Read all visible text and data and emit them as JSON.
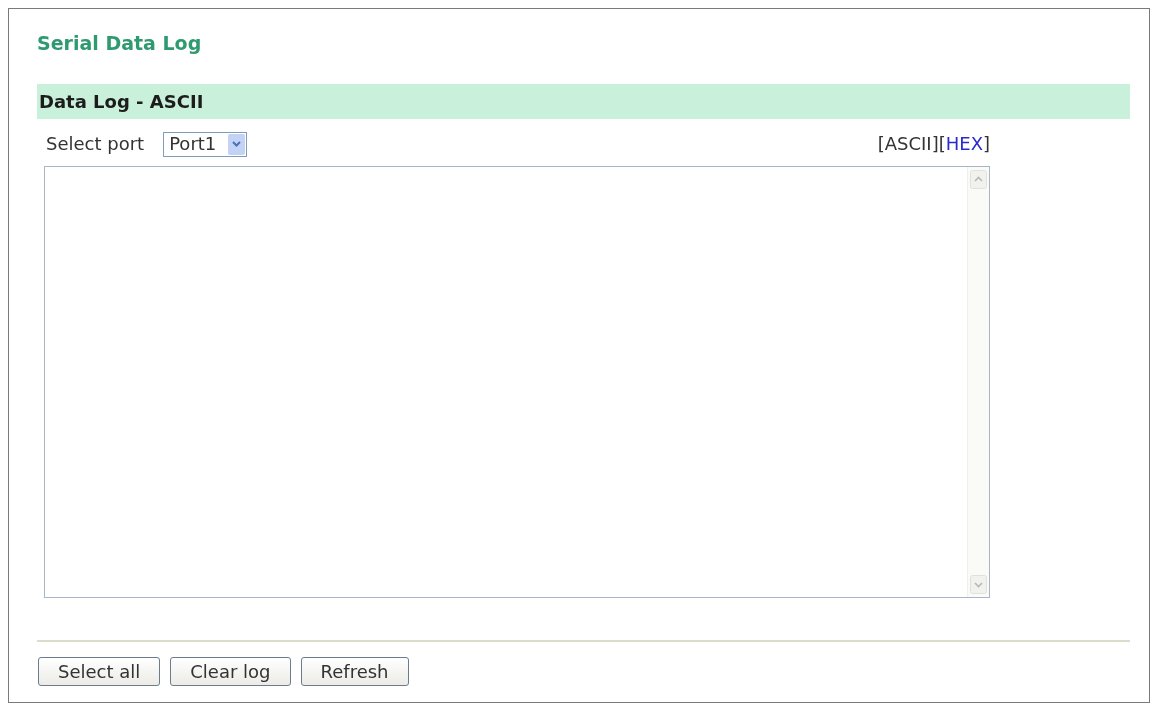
{
  "title": "Serial Data Log",
  "section": {
    "title": "Data Log - ASCII"
  },
  "port_select": {
    "label": "Select port",
    "value": "Port1"
  },
  "view_links": [
    {
      "prefix": "[",
      "label": "ASCII",
      "suffix": "]",
      "selected": true
    },
    {
      "prefix": "[",
      "label": "HEX",
      "suffix": "]",
      "selected": false
    }
  ],
  "buttons": [
    "Select all",
    "Clear log",
    "Refresh"
  ]
}
